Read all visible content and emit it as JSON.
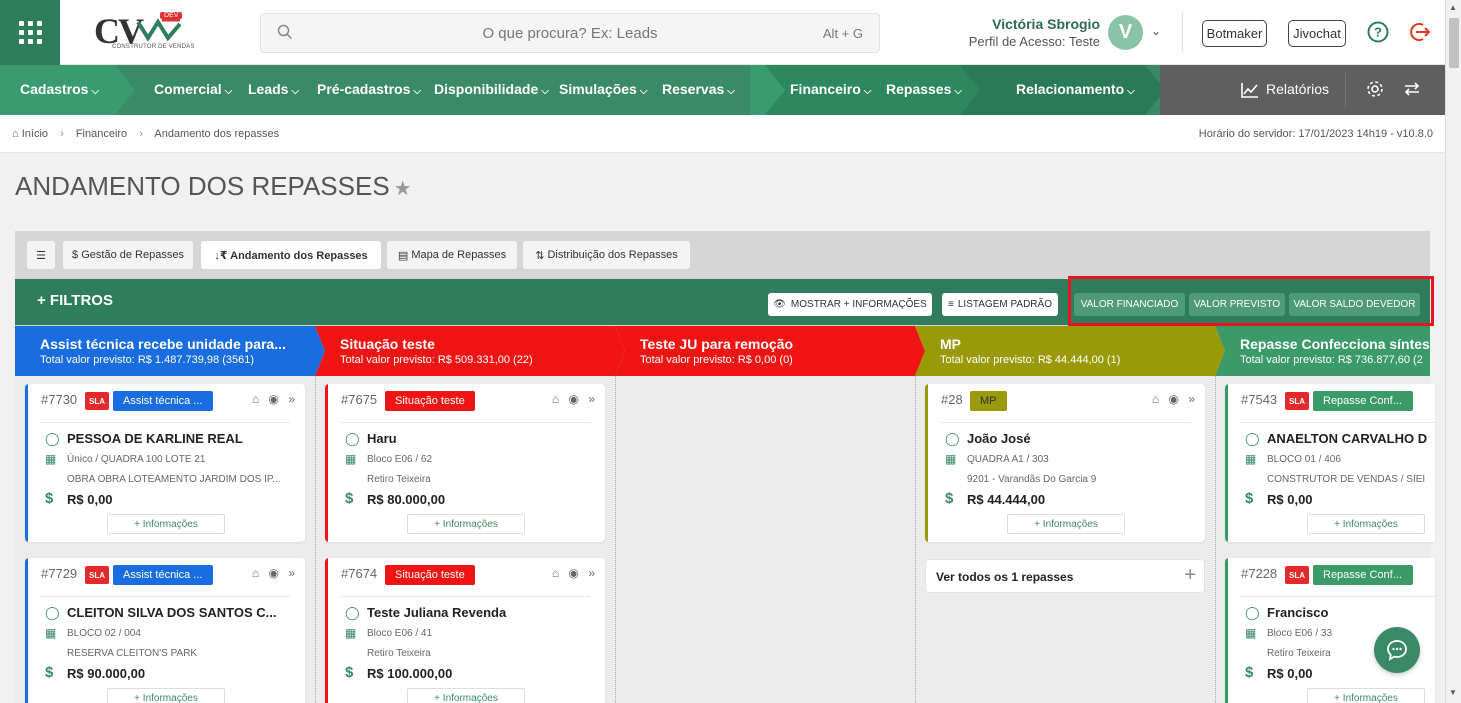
{
  "header": {
    "logo_text": "CV",
    "logo_badge": "DEV",
    "logo_subtitle": "CONSTRUTOR DE VENDAS",
    "search_placeholder": "O que procura? Ex: Leads",
    "search_shortcut": "Alt + G",
    "user_name": "Victória Sbrogio",
    "user_profile": "Perfil de Acesso: Teste",
    "avatar_letter": "V",
    "botmaker_label": "Botmaker",
    "jivochat_label": "Jivochat"
  },
  "nav": {
    "items": [
      {
        "label": "Cadastros"
      },
      {
        "label": "Comercial"
      },
      {
        "label": "Leads"
      },
      {
        "label": "Pré-cadastros"
      },
      {
        "label": "Disponibilidade"
      },
      {
        "label": "Simulações"
      },
      {
        "label": "Reservas"
      },
      {
        "label": "Financeiro"
      },
      {
        "label": "Repasses"
      },
      {
        "label": "Relacionamento"
      }
    ],
    "reports_label": "Relatórios"
  },
  "breadcrumb": {
    "items": [
      "Início",
      "Financeiro",
      "Andamento dos repasses"
    ],
    "server_time": "Horário do servidor: 17/01/2023 14h19 - v10.8.0"
  },
  "page_title": "ANDAMENTO DOS REPASSES",
  "tabs": [
    {
      "label": "$ Gestão de Repasses"
    },
    {
      "label": "↓₹ Andamento dos Repasses"
    },
    {
      "label": "Mapa de Repasses"
    },
    {
      "label": "Distribuição dos Repasses"
    }
  ],
  "filters": {
    "title": "+ FILTROS",
    "show_more": "MOSTRAR + INFORMAÇÕES",
    "default_list": "LISTAGEM PADRÃO",
    "value_financed": "VALOR FINANCIADO",
    "value_forecast": "VALOR PREVISTO",
    "value_balance": "VALOR SALDO DEVEDOR"
  },
  "columns": [
    {
      "title": "Assist técnica recebe unidade para...",
      "subtitle": "Total valor previsto: R$ 1.487.739,98 (3561)",
      "color": "#1a6de0"
    },
    {
      "title": "Situação teste",
      "subtitle": "Total valor previsto: R$ 509.331,00 (22)",
      "color": "#f01414"
    },
    {
      "title": "Teste JU para remoção",
      "subtitle": "Total valor previsto: R$ 0,00 (0)",
      "color": "#f01414"
    },
    {
      "title": "MP",
      "subtitle": "Total valor previsto: R$ 44.444,00 (1)",
      "color": "#9a9a08"
    },
    {
      "title": "Repasse Confecciona síntese",
      "subtitle": "Total valor previsto: R$ 736.877,60 (2",
      "color": "#3a9a68"
    }
  ],
  "cards": {
    "c1a": {
      "num": "#7730",
      "sla": "SLA",
      "tag": "Assist técnica ...",
      "name": "PESSOA DE KARLINE REAL",
      "unit": "Único / QUADRA 100 LOTE 21",
      "emp": "OBRA OBRA LOTEAMENTO JARDIM DOS IP...",
      "value": "R$ 0,00",
      "more": "+ Informações"
    },
    "c1b": {
      "num": "#7729",
      "sla": "SLA",
      "tag": "Assist técnica ...",
      "name": "CLEITON SILVA DOS SANTOS C...",
      "unit": "BLOCO 02 / 004",
      "emp": "RESERVA CLEITON'S PARK",
      "value": "R$ 90.000,00",
      "more": "+ Informações"
    },
    "c2a": {
      "num": "#7675",
      "tag": "Situação teste",
      "name": "Haru",
      "unit": "Bloco E06 / 62",
      "emp": "Retiro Teixeira",
      "value": "R$ 80.000,00",
      "more": "+ Informações"
    },
    "c2b": {
      "num": "#7674",
      "tag": "Situação teste",
      "name": "Teste Juliana Revenda",
      "unit": "Bloco E06 / 41",
      "emp": "Retiro Teixeira",
      "value": "R$ 100.000,00",
      "more": "+ Informações"
    },
    "c4a": {
      "num": "#28",
      "tag": "MP",
      "name": "João José",
      "unit": "QUADRA A1 / 303",
      "emp": "9201 - Varandãs Do Garcia 9",
      "value": "R$ 44.444,00",
      "more": "+ Informações"
    },
    "c5a": {
      "num": "#7543",
      "sla": "SLA",
      "tag": "Repasse Conf...",
      "name": "ANAELTON CARVALHO D",
      "unit": "BLOCO 01 / 406",
      "emp": "CONSTRUTOR DE VENDAS / SIEI",
      "value": "R$ 0,00",
      "more": "+ Informações"
    },
    "c5b": {
      "num": "#7228",
      "sla": "SLA",
      "tag": "Repasse Conf...",
      "name": "Francisco",
      "unit": "Bloco E06 / 33",
      "emp": "Retiro Teixeira",
      "value": "R$ 0,00",
      "more": "+ Informações"
    }
  },
  "see_all": "Ver todos os 1 repasses"
}
